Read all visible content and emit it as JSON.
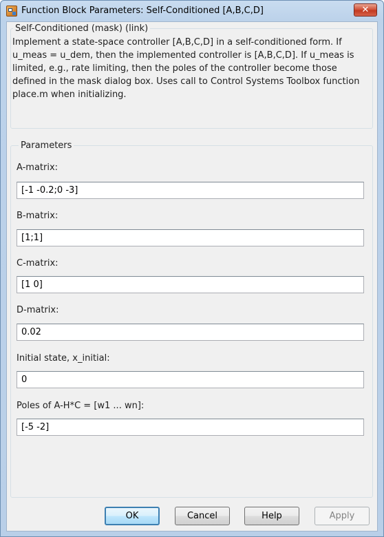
{
  "window": {
    "title": "Function Block Parameters: Self-Conditioned [A,B,C,D]",
    "close_glyph": "✕"
  },
  "mask": {
    "group_title": "Self-Conditioned (mask) (link)",
    "description": "Implement a state-space controller [A,B,C,D] in a self-conditioned form. If u_meas = u_dem, then the implemented controller is [A,B,C,D]. If u_meas is limited, e.g., rate limiting, then the poles of the controller become those defined in the mask dialog box. Uses call to Control Systems Toolbox function place.m when initializing."
  },
  "parameters": {
    "group_title": "Parameters",
    "fields": [
      {
        "label": "A-matrix:",
        "value": "[-1 -0.2;0 -3]"
      },
      {
        "label": "B-matrix:",
        "value": "[1;1]"
      },
      {
        "label": "C-matrix:",
        "value": "[1 0]"
      },
      {
        "label": "D-matrix:",
        "value": "0.02"
      },
      {
        "label": "Initial state, x_initial:",
        "value": "0"
      },
      {
        "label": "Poles of A-H*C = [w1 ... wn]:",
        "value": "[-5 -2]"
      }
    ]
  },
  "buttons": {
    "ok": "OK",
    "cancel": "Cancel",
    "help": "Help",
    "apply": "Apply"
  }
}
